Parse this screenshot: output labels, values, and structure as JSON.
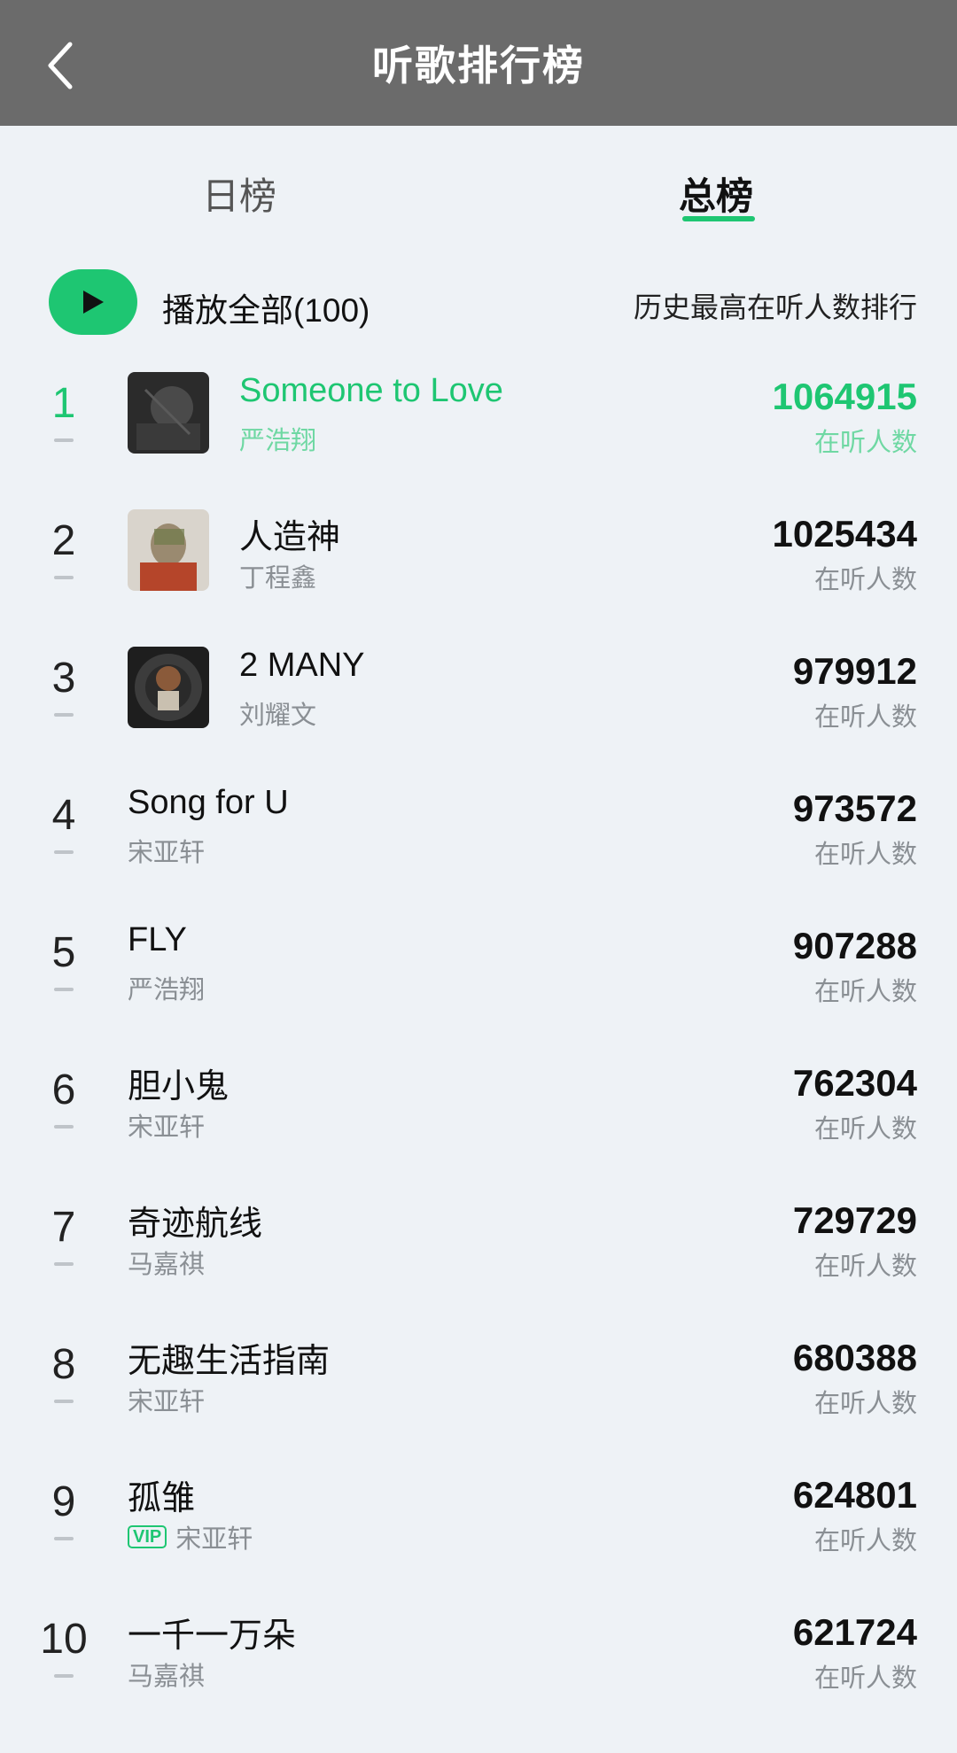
{
  "header": {
    "title": "听歌排行榜"
  },
  "tabs": [
    {
      "label": "日榜"
    },
    {
      "label": "总榜"
    }
  ],
  "playbar": {
    "play_all_label": "播放全部(100)",
    "sort_label": "历史最高在听人数排行"
  },
  "count_label": "在听人数",
  "songs": [
    {
      "rank": "1",
      "title": "Someone to Love",
      "artist": "严浩翔",
      "count": "1064915"
    },
    {
      "rank": "2",
      "title": "人造神",
      "artist": "丁程鑫",
      "count": "1025434"
    },
    {
      "rank": "3",
      "title": "2 MANY",
      "artist": "刘耀文",
      "count": "979912"
    },
    {
      "rank": "4",
      "title": "Song for U",
      "artist": "宋亚轩",
      "count": "973572"
    },
    {
      "rank": "5",
      "title": "FLY",
      "artist": "严浩翔",
      "count": "907288"
    },
    {
      "rank": "6",
      "title": "胆小鬼",
      "artist": "宋亚轩",
      "count": "762304"
    },
    {
      "rank": "7",
      "title": "奇迹航线",
      "artist": "马嘉祺",
      "count": "729729"
    },
    {
      "rank": "8",
      "title": "无趣生活指南",
      "artist": "宋亚轩",
      "count": "680388"
    },
    {
      "rank": "9",
      "title": "孤雏",
      "artist": "宋亚轩",
      "count": "624801",
      "badge": "VIP"
    },
    {
      "rank": "10",
      "title": "一千一万朵",
      "artist": "马嘉祺",
      "count": "621724"
    }
  ],
  "colors": {
    "accent": "#1ec672",
    "header_bg": "#6b6b6b",
    "page_bg": "#eef2f6"
  },
  "icons": {
    "back": "chevron-left-icon",
    "play": "play-icon"
  }
}
